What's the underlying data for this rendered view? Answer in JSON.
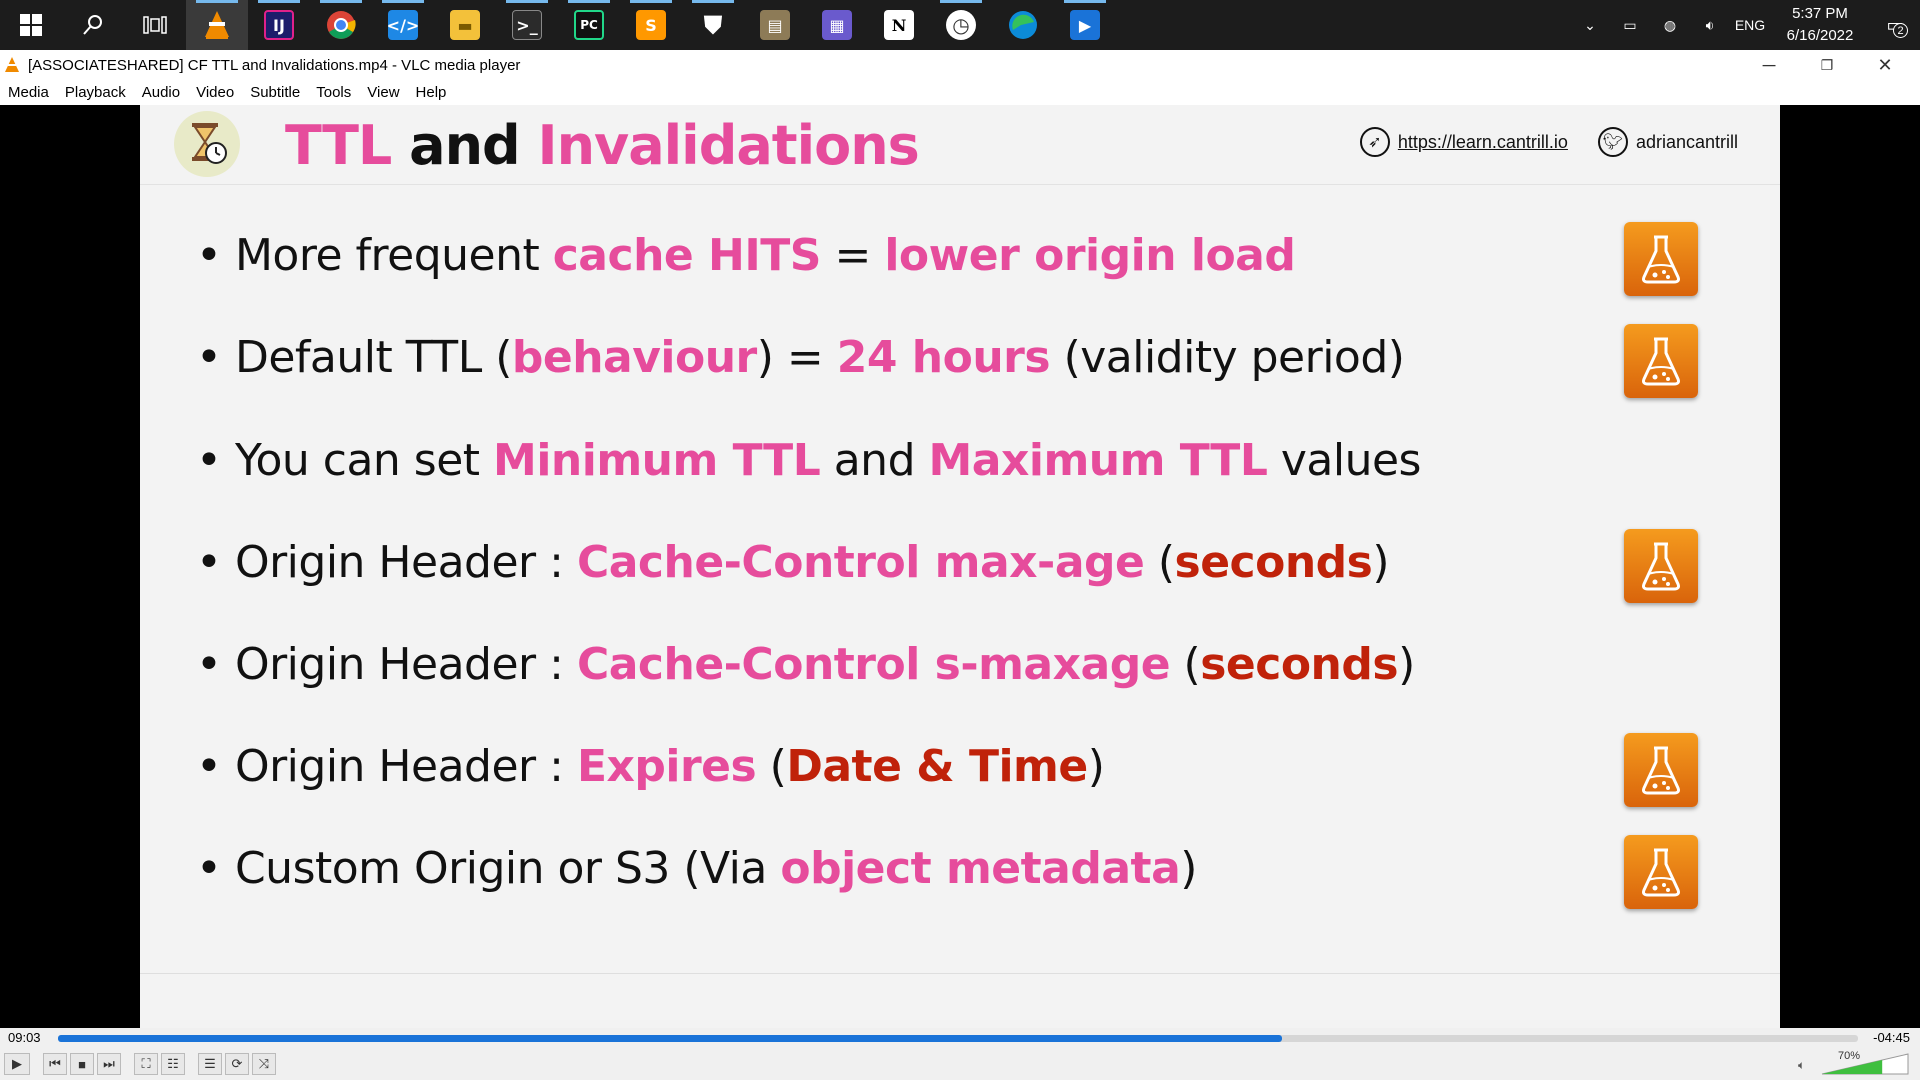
{
  "window": {
    "title": "[ASSOCIATESHARED] CF TTL and Invalidations.mp4 - VLC media player"
  },
  "menu": [
    "Media",
    "Playback",
    "Audio",
    "Video",
    "Subtitle",
    "Tools",
    "View",
    "Help"
  ],
  "tray": {
    "lang": "ENG",
    "time": "5:37 PM",
    "date": "6/16/2022",
    "notifications": "2"
  },
  "slide": {
    "title_part1": "TTL",
    "title_part2": "and",
    "title_part3": "Invalidations",
    "link": "https://learn.cantrill.io",
    "twitter": "adriancantrill",
    "bullets": [
      {
        "segments": [
          {
            "t": "More frequent ",
            "c": "n"
          },
          {
            "t": "cache HITS",
            "c": "p"
          },
          {
            "t": " = ",
            "c": "n"
          },
          {
            "t": "lower origin load",
            "c": "p"
          }
        ],
        "lab": true
      },
      {
        "segments": [
          {
            "t": "Default TTL (",
            "c": "n"
          },
          {
            "t": "behaviour",
            "c": "p"
          },
          {
            "t": ") = ",
            "c": "n"
          },
          {
            "t": "24 hours",
            "c": "p"
          },
          {
            "t": " (validity period)",
            "c": "n"
          }
        ],
        "lab": true
      },
      {
        "segments": [
          {
            "t": "You can set ",
            "c": "n"
          },
          {
            "t": "Minimum TTL",
            "c": "p"
          },
          {
            "t": " and ",
            "c": "n"
          },
          {
            "t": "Maximum TTL",
            "c": "p"
          },
          {
            "t": " values",
            "c": "n"
          }
        ],
        "lab": false
      },
      {
        "segments": [
          {
            "t": "Origin Header : ",
            "c": "n"
          },
          {
            "t": "Cache-Control max-age",
            "c": "p"
          },
          {
            "t": " (",
            "c": "n"
          },
          {
            "t": "seconds",
            "c": "r"
          },
          {
            "t": ")",
            "c": "n"
          }
        ],
        "lab": true
      },
      {
        "segments": [
          {
            "t": "Origin Header : ",
            "c": "n"
          },
          {
            "t": "Cache-Control s-maxage",
            "c": "p"
          },
          {
            "t": " (",
            "c": "n"
          },
          {
            "t": "seconds",
            "c": "r"
          },
          {
            "t": ")",
            "c": "n"
          }
        ],
        "lab": false
      },
      {
        "segments": [
          {
            "t": "Origin Header : ",
            "c": "n"
          },
          {
            "t": "Expires",
            "c": "p"
          },
          {
            "t": " (",
            "c": "n"
          },
          {
            "t": "Date & Time",
            "c": "r"
          },
          {
            "t": ")",
            "c": "n"
          }
        ],
        "lab": true
      },
      {
        "segments": [
          {
            "t": "Custom Origin or S3 (Via ",
            "c": "n"
          },
          {
            "t": "object metadata",
            "c": "p"
          },
          {
            "t": ")",
            "c": "n"
          }
        ],
        "lab": true
      }
    ]
  },
  "player": {
    "elapsed": "09:03",
    "remaining": "-04:45",
    "progress": 0.68,
    "volume": "70%"
  },
  "colors": {
    "pink": "#e64c9c",
    "red": "#c0220a",
    "seek": "#1a73d8"
  }
}
